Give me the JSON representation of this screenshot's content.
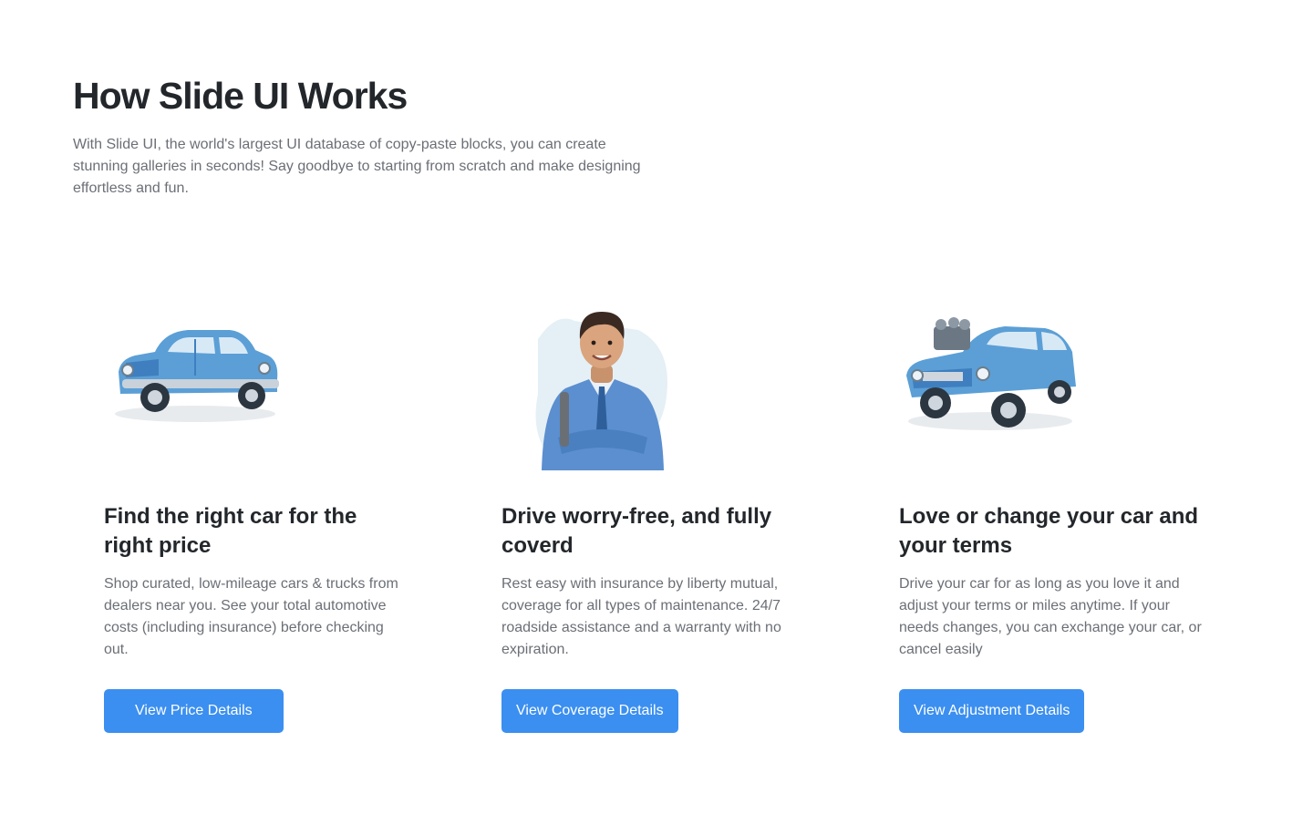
{
  "header": {
    "title": "How Slide UI Works",
    "intro": "With Slide UI, the world's largest UI database of copy-paste blocks, you can create stunning galleries in seconds! Say goodbye to starting from scratch and make designing effortless and fun."
  },
  "colors": {
    "button": "#3b8ff0",
    "title": "#23272b",
    "body": "#6b6f76",
    "illustration_blue": "#5b9fd6"
  },
  "cards": [
    {
      "image": "blue-vintage-car-illustration",
      "title": "Find the right car for the right price",
      "text": "Shop curated, low-mileage cars & trucks from dealers near you. See your total automotive costs (including insurance) before checking out.",
      "button": "View Price Details"
    },
    {
      "image": "smiling-man-illustration",
      "title": "Drive worry-free, and fully coverd",
      "text": "Rest easy with insurance by liberty mutual, coverage for all types of maintenance. 24/7 roadside assistance and a warranty with no expiration.",
      "button": "View Coverage Details"
    },
    {
      "image": "blue-hot-rod-car-illustration",
      "title": "Love or change your car and your terms",
      "text": "Drive your car for as long as you love it and adjust your terms or miles anytime. If your needs changes, you can exchange your car, or cancel easily",
      "button": "View Adjustment Details"
    }
  ]
}
